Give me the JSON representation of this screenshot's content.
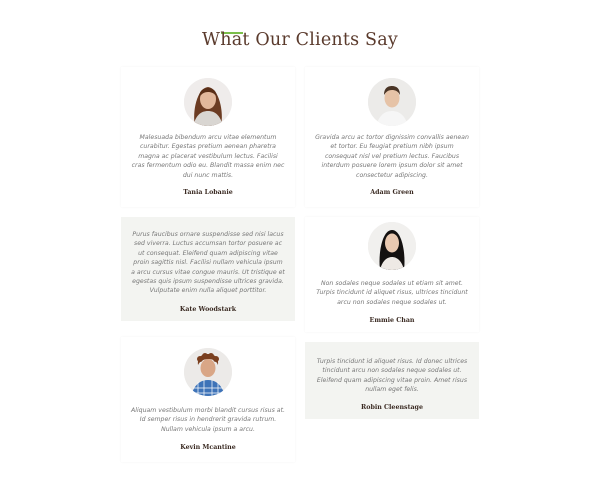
{
  "section": {
    "title": "What Our Clients Say",
    "accent_color": "#7bbf4a",
    "title_color": "#5a3a2c"
  },
  "testimonials": [
    {
      "quote": "Malesuada bibendum arcu vitae elementum curabitur. Egestas pretium aenean pharetra magna ac placerat vestibulum lectus. Facilisi cras fermentum odio eu. Blandit massa enim nec dui nunc mattis.",
      "name": "Tania Lobanie",
      "avatar": "woman-long-hair-photo"
    },
    {
      "quote": "Gravida arcu ac tortor dignissim convallis aenean et tortor. Eu feugiat pretium nibh ipsum consequat nisl vel pretium lectus. Faucibus interdum posuere lorem ipsum dolor sit amet consectetur adipiscing.",
      "name": "Adam Green",
      "avatar": "man-white-shirt-photo"
    },
    {
      "quote": "Purus faucibus ornare suspendisse sed nisi lacus sed viverra. Luctus accumsan tortor posuere ac ut consequat. Eleifend quam adipiscing vitae proin sagittis nisl. Facilisi nullam vehicula ipsum a arcu cursus vitae congue mauris. Ut tristique et egestas quis ipsum suspendisse ultrices gravida. Vulputate enim nulla aliquet porttitor.",
      "name": "Kate Woodstark"
    },
    {
      "quote": "Non sodales neque sodales ut etiam sit amet. Turpis tincidunt id aliquet risus, ultrices tincidunt arcu non sodales neque sodales ut.",
      "name": "Emmie Chan",
      "avatar": "woman-dark-hair-photo"
    },
    {
      "quote": "Aliquam vestibulum morbi blandit cursus risus at. Id semper risus in hendrerit gravida rutrum. Nullam vehicula ipsum a arcu.",
      "name": "Kevin Mcantine",
      "avatar": "man-curly-hair-photo"
    },
    {
      "quote": "Turpis tincidunt id aliquet risus. Id donec ultrices tincidunt arcu non sodales neque sodales ut. Eleifend quam adipiscing vitae proin. Amet risus nullam eget felis.",
      "name": "Robin Cleenstage"
    }
  ]
}
